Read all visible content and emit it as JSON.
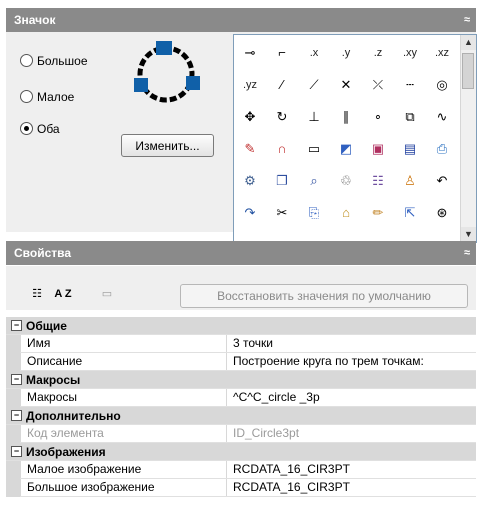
{
  "icon_panel": {
    "title": "Значок",
    "collapse_glyph": "≈",
    "radio_options": [
      {
        "label": "Большое",
        "checked": false
      },
      {
        "label": "Малое",
        "checked": false
      },
      {
        "label": "Оба",
        "checked": true
      }
    ],
    "change_button": "Изменить...",
    "grid_text_items": [
      ".x",
      ".y",
      ".z",
      ".xy",
      ".xz",
      ".yz"
    ],
    "scroll_up": "▲",
    "scroll_down": "▼"
  },
  "props_panel": {
    "title": "Свойства",
    "collapse_glyph": "≈",
    "restore_button": "Восстановить значения по умолчанию",
    "sort_label": "A Z",
    "categories": [
      {
        "label": "Общие",
        "rows": [
          {
            "name": "Имя",
            "value": "3 точки"
          },
          {
            "name": "Описание",
            "value": "Построение круга по трем точкам:"
          }
        ]
      },
      {
        "label": "Макросы",
        "rows": [
          {
            "name": "Макросы",
            "value": "^C^C_circle _3p"
          }
        ]
      },
      {
        "label": "Дополнительно",
        "rows": [
          {
            "name": "Код элемента",
            "value": "ID_Circle3pt"
          }
        ]
      },
      {
        "label": "Изображения",
        "rows": [
          {
            "name": "Малое изображение",
            "value": "RCDATA_16_CIR3PT"
          },
          {
            "name": "Большое изображение",
            "value": "RCDATA_16_CIR3PT"
          }
        ]
      }
    ]
  }
}
